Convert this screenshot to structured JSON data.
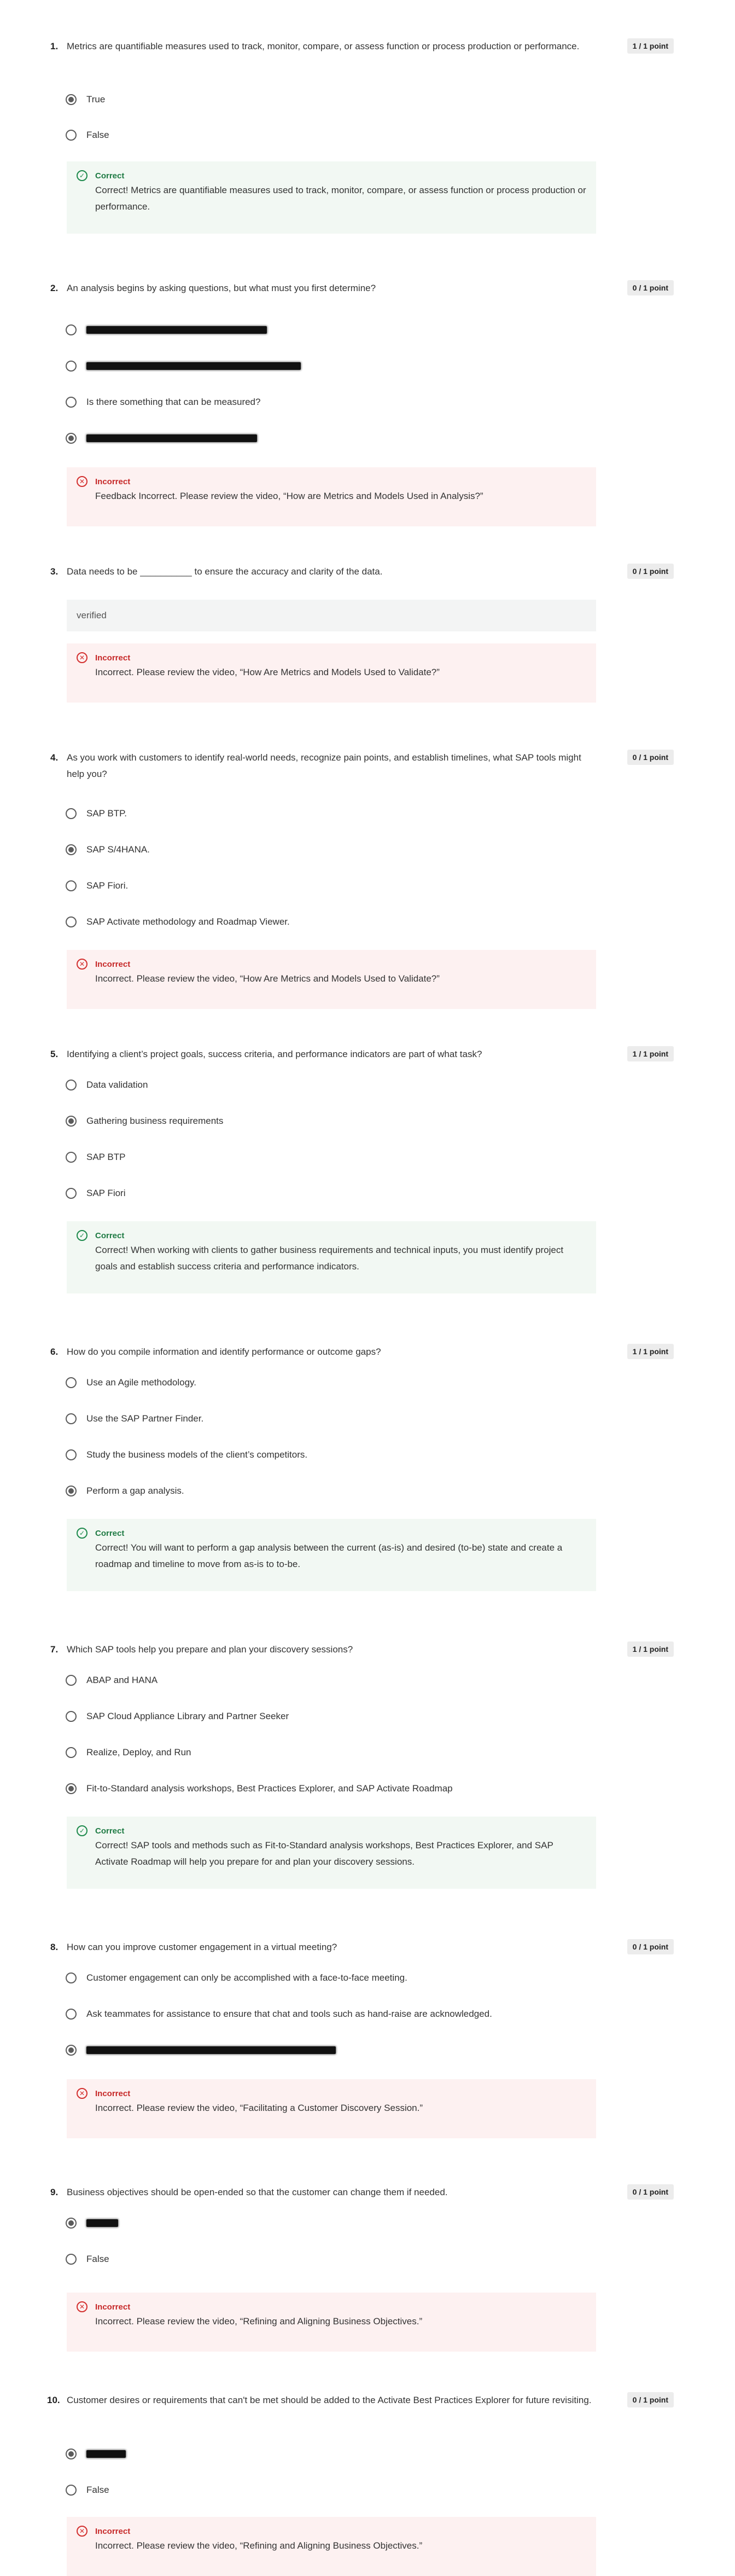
{
  "questions": [
    {
      "number": "1.",
      "text": "Metrics are quantifiable measures used to track, monitor, compare, or assess function or process production or performance.",
      "points": "1 / 1 point",
      "options": [
        {
          "label": "True",
          "selected": true
        },
        {
          "label": "False",
          "selected": false
        }
      ],
      "feedback": {
        "status": "Correct",
        "text": "Correct! Metrics are quantifiable measures used to track, monitor, compare, or assess function or process production or performance."
      }
    },
    {
      "number": "2.",
      "text": "An analysis begins by asking questions, but what must you first determine?",
      "points": "0 / 1 point",
      "options": [
        {
          "label": "",
          "selected": false,
          "redacted": true
        },
        {
          "label": "",
          "selected": false,
          "redacted": true
        },
        {
          "label": "Is there something that can be measured?",
          "selected": false
        },
        {
          "label": "",
          "selected": true,
          "redacted": true
        }
      ],
      "feedback": {
        "status": "Incorrect",
        "text": "Feedback Incorrect. Please review the video, “How are Metrics and Models Used in Analysis?”"
      }
    },
    {
      "number": "3.",
      "text": "Data needs to be __________ to ensure the accuracy and clarity of the data.",
      "points": "0 / 1 point",
      "answer": "verified",
      "feedback": {
        "status": "Incorrect",
        "text": "Incorrect. Please review the video, “How Are Metrics and Models Used to Validate?”"
      }
    },
    {
      "number": "4.",
      "text": "As you work with customers to identify real-world needs, recognize pain points, and establish timelines, what SAP tools might help you?",
      "points": "0 / 1 point",
      "options": [
        {
          "label": "SAP BTP.",
          "selected": false
        },
        {
          "label": "SAP S/4HANA.",
          "selected": true
        },
        {
          "label": "SAP Fiori.",
          "selected": false
        },
        {
          "label": "SAP Activate methodology and Roadmap Viewer.",
          "selected": false
        }
      ],
      "feedback": {
        "status": "Incorrect",
        "text": "Incorrect. Please review the video, “How Are Metrics and Models Used to Validate?”"
      }
    },
    {
      "number": "5.",
      "text": "Identifying a client’s project goals, success criteria, and performance indicators are part of what task?",
      "points": "1 / 1 point",
      "options": [
        {
          "label": "Data validation",
          "selected": false
        },
        {
          "label": "Gathering business requirements",
          "selected": true
        },
        {
          "label": "SAP BTP",
          "selected": false
        },
        {
          "label": "SAP Fiori",
          "selected": false
        }
      ],
      "feedback": {
        "status": "Correct",
        "text": "Correct! When working with clients to gather business requirements and technical inputs, you must identify project goals and establish success criteria and performance indicators."
      }
    },
    {
      "number": "6.",
      "text": "How do you compile information and identify performance or outcome gaps?",
      "points": "1 / 1 point",
      "options": [
        {
          "label": "Use an Agile methodology.",
          "selected": false
        },
        {
          "label": "Use the SAP Partner Finder.",
          "selected": false
        },
        {
          "label": "Study the business models of the client’s competitors.",
          "selected": false
        },
        {
          "label": "Perform a gap analysis.",
          "selected": true
        }
      ],
      "feedback": {
        "status": "Correct",
        "text": "Correct! You will want to perform a gap analysis between the current (as-is) and desired (to-be) state and create a roadmap and timeline to move from as-is to to-be."
      }
    },
    {
      "number": "7.",
      "text": "Which SAP tools help you prepare and plan your discovery sessions?",
      "points": "1 / 1 point",
      "options": [
        {
          "label": "ABAP and HANA",
          "selected": false
        },
        {
          "label": "SAP Cloud Appliance Library and Partner Seeker",
          "selected": false
        },
        {
          "label": "Realize, Deploy, and Run",
          "selected": false
        },
        {
          "label": "Fit-to-Standard analysis workshops, Best Practices Explorer, and SAP Activate Roadmap",
          "selected": true
        }
      ],
      "feedback": {
        "status": "Correct",
        "text": "Correct! SAP tools and methods such as Fit-to-Standard analysis workshops, Best Practices Explorer, and SAP Activate Roadmap will help you prepare for and plan your discovery sessions."
      }
    },
    {
      "number": "8.",
      "text": "How can you improve customer engagement in a virtual meeting?",
      "points": "0 / 1 point",
      "options": [
        {
          "label": "Customer engagement can only be accomplished with a face-to-face meeting.",
          "selected": false
        },
        {
          "label": "Ask teammates for assistance to ensure that chat and tools such as hand-raise are acknowledged.",
          "selected": false
        },
        {
          "label": "",
          "selected": true,
          "redacted": true
        }
      ],
      "feedback": {
        "status": "Incorrect",
        "text": "Incorrect. Please review the video, “Facilitating a Customer Discovery Session.”"
      }
    },
    {
      "number": "9.",
      "text": "Business objectives should be open-ended so that the customer can change them if needed.",
      "points": "0 / 1 point",
      "options": [
        {
          "label": "",
          "selected": true,
          "redacted": true
        },
        {
          "label": "False",
          "selected": false
        }
      ],
      "feedback": {
        "status": "Incorrect",
        "text": "Incorrect. Please review the video, “Refining and Aligning Business Objectives.”"
      }
    },
    {
      "number": "10.",
      "text": "Customer desires or requirements that can't be met should be added to the Activate Best Practices Explorer for future revisiting.",
      "points": "0 / 1 point",
      "options": [
        {
          "label": "",
          "selected": true,
          "redacted": true
        },
        {
          "label": "False",
          "selected": false
        }
      ],
      "feedback": {
        "status": "Incorrect",
        "text": "Incorrect. Please review the video, “Refining and Aligning Business Objectives.”"
      }
    }
  ]
}
